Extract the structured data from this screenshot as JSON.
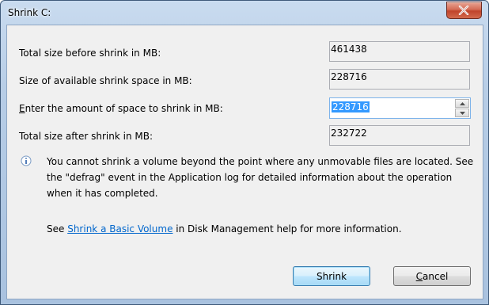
{
  "window": {
    "title": "Shrink C:",
    "close_icon": "close-icon"
  },
  "fields": {
    "total_before_label": "Total size before shrink in MB:",
    "total_before_value": "461438",
    "available_label": "Size of available shrink space in MB:",
    "available_value": "228716",
    "amount_label_prefix": "E",
    "amount_label_rest": "nter the amount of space to shrink in MB:",
    "amount_value": "228716",
    "total_after_label": "Total size after shrink in MB:",
    "total_after_value": "232722"
  },
  "info": {
    "icon": "info-icon",
    "text": "You cannot shrink a volume beyond the point where any unmovable files are located. See the \"defrag\" event in the Application log for detailed information about the operation when it has completed."
  },
  "help": {
    "prefix": "See ",
    "link_text": "Shrink a Basic Volume",
    "suffix": " in Disk Management help for more information."
  },
  "buttons": {
    "shrink": "Shrink",
    "cancel_mnemonic": "C",
    "cancel_rest": "ancel"
  }
}
